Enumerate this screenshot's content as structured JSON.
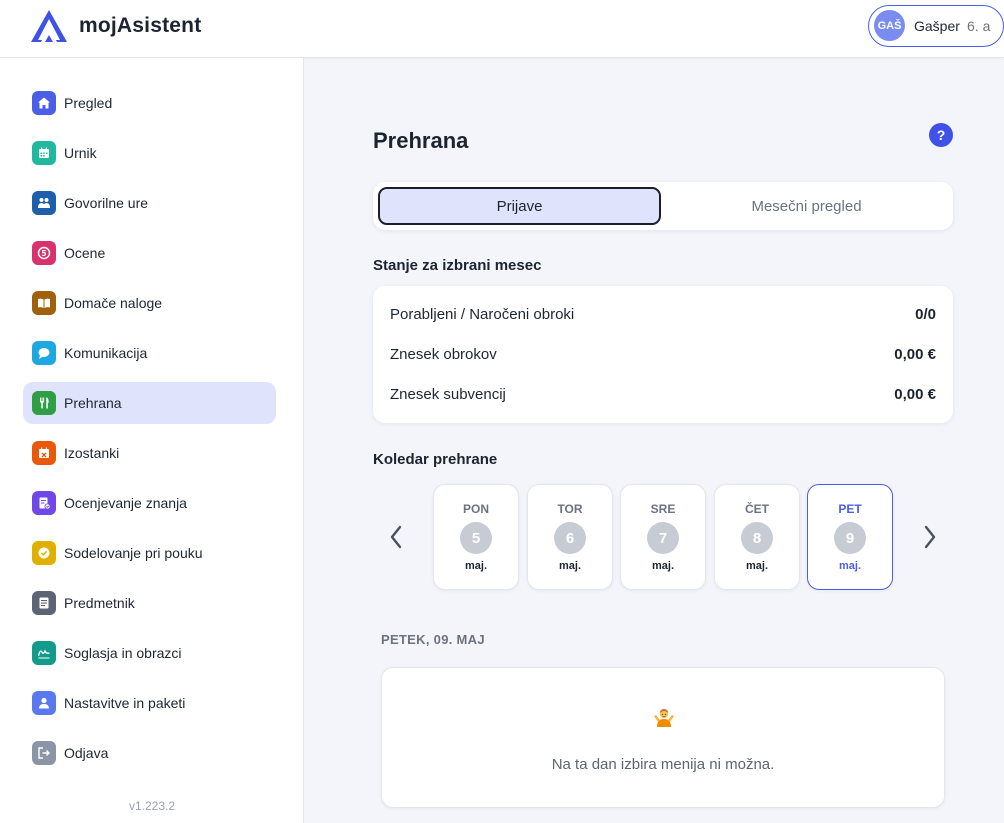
{
  "app": {
    "name": "mojAsistent",
    "version": "v1.223.2"
  },
  "user": {
    "initials": "GAŠ",
    "name": "Gašper",
    "class": "6. a"
  },
  "sidebar": {
    "items": [
      {
        "label": "Pregled",
        "icon": "home-icon",
        "color": "#4b5ee6"
      },
      {
        "label": "Urnik",
        "icon": "calendar-icon",
        "color": "#22b8a0"
      },
      {
        "label": "Govorilne ure",
        "icon": "people-icon",
        "color": "#1d5fa8"
      },
      {
        "label": "Ocene",
        "icon": "grade-icon",
        "color": "#d6336c"
      },
      {
        "label": "Domače naloge",
        "icon": "book-icon",
        "color": "#a0600c"
      },
      {
        "label": "Komunikacija",
        "icon": "chat-icon",
        "color": "#1ea7e0"
      },
      {
        "label": "Prehrana",
        "icon": "cutlery-icon",
        "color": "#2f9e44",
        "active": true
      },
      {
        "label": "Izostanki",
        "icon": "calendar-x-icon",
        "color": "#e8590c"
      },
      {
        "label": "Ocenjevanje znanja",
        "icon": "test-icon",
        "color": "#7048e8"
      },
      {
        "label": "Sodelovanje pri pouku",
        "icon": "check-badge-icon",
        "color": "#e0b000"
      },
      {
        "label": "Predmetnik",
        "icon": "list-icon",
        "color": "#5c6475"
      },
      {
        "label": "Soglasja in obrazci",
        "icon": "signature-icon",
        "color": "#129b8a"
      },
      {
        "label": "Nastavitve in paketi",
        "icon": "user-icon",
        "color": "#5a78f0"
      },
      {
        "label": "Odjava",
        "icon": "logout-icon",
        "color": "#8c95a6"
      }
    ]
  },
  "main": {
    "title": "Prehrana",
    "help": "?",
    "tabs": [
      {
        "label": "Prijave",
        "active": true
      },
      {
        "label": "Mesečni pregled",
        "active": false
      }
    ],
    "summary": {
      "title": "Stanje za izbrani mesec",
      "rows": [
        {
          "label": "Porabljeni / Naročeni obroki",
          "value": "0/0"
        },
        {
          "label": "Znesek obrokov",
          "value": "0,00 €"
        },
        {
          "label": "Znesek subvencij",
          "value": "0,00 €"
        }
      ]
    },
    "calendar": {
      "title": "Koledar prehrane",
      "days": [
        {
          "name": "PON",
          "num": "5",
          "month": "maj.",
          "selected": false
        },
        {
          "name": "TOR",
          "num": "6",
          "month": "maj.",
          "selected": false
        },
        {
          "name": "SRE",
          "num": "7",
          "month": "maj.",
          "selected": false
        },
        {
          "name": "ČET",
          "num": "8",
          "month": "maj.",
          "selected": false
        },
        {
          "name": "PET",
          "num": "9",
          "month": "maj.",
          "selected": true
        }
      ]
    },
    "selected_day": {
      "heading": "PETEK, 09. MAJ",
      "message": "Na ta dan izbira menija ni možna.",
      "icon": "shrug-icon"
    }
  }
}
